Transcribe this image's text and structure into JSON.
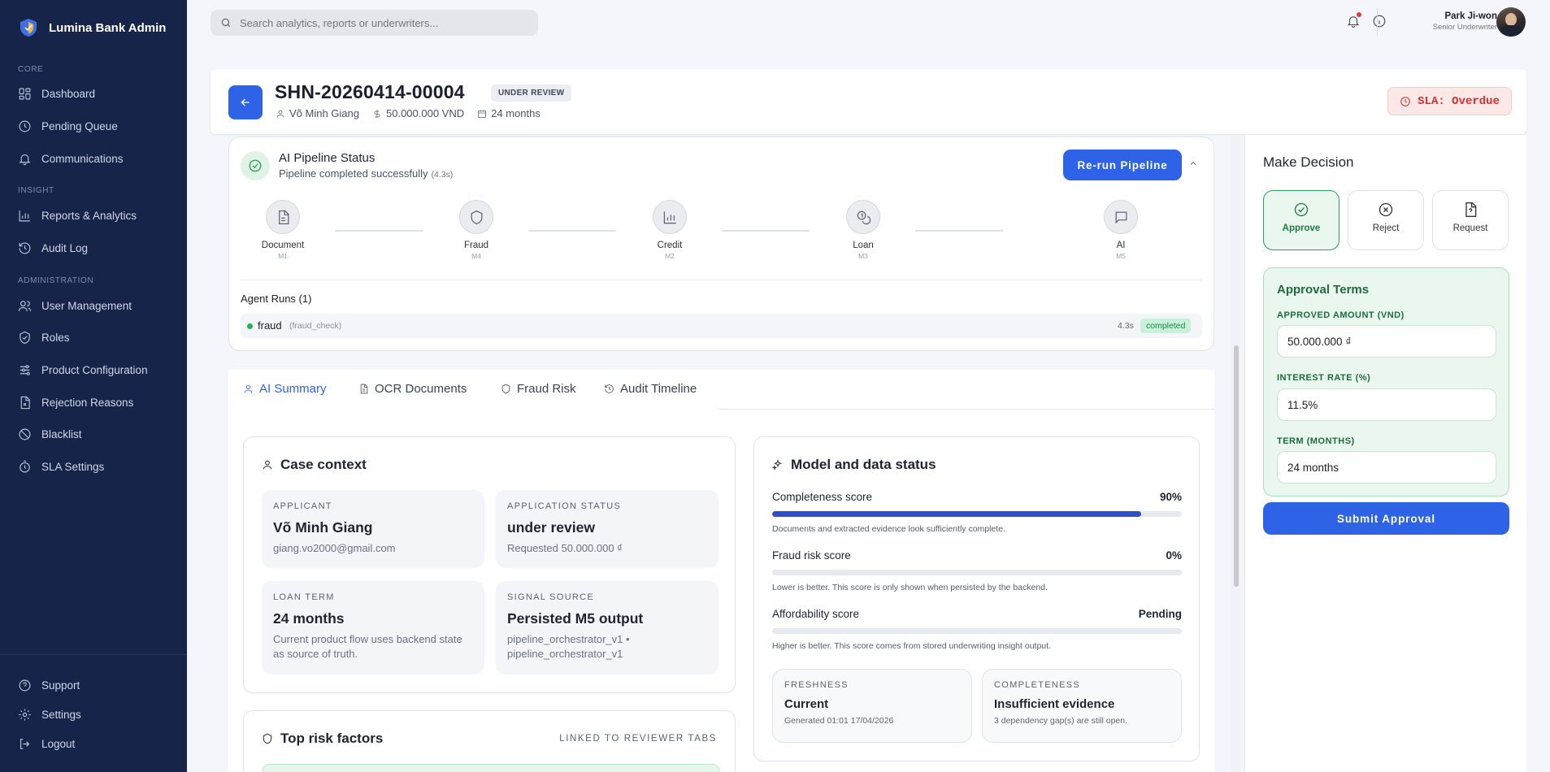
{
  "app": {
    "name": "Lumina Bank Admin"
  },
  "sidebar": {
    "sections": {
      "core": "CORE",
      "insight": "INSIGHT",
      "administration": "ADMINISTRATION"
    },
    "items": [
      {
        "label": "Dashboard",
        "icon": "grid-icon"
      },
      {
        "label": "Pending Queue",
        "icon": "clock-icon"
      },
      {
        "label": "Communications",
        "icon": "bell-icon"
      },
      {
        "label": "Reports & Analytics",
        "icon": "bar-chart-icon"
      },
      {
        "label": "Audit Log",
        "icon": "history-icon"
      },
      {
        "label": "User Management",
        "icon": "users-icon"
      },
      {
        "label": "Roles",
        "icon": "shield-check-icon"
      },
      {
        "label": "Product Configuration",
        "icon": "sliders-icon"
      },
      {
        "label": "Rejection Reasons",
        "icon": "file-x-icon"
      },
      {
        "label": "Blacklist",
        "icon": "ban-icon"
      },
      {
        "label": "SLA Settings",
        "icon": "timer-icon"
      }
    ],
    "footer": [
      {
        "label": "Support",
        "icon": "help-icon"
      },
      {
        "label": "Settings",
        "icon": "gear-icon"
      },
      {
        "label": "Logout",
        "icon": "logout-icon"
      }
    ]
  },
  "header": {
    "search_placeholder": "Search analytics, reports or underwriters...",
    "user": {
      "name": "Park Ji-won",
      "role": "Senior Underwriter"
    }
  },
  "case": {
    "id": "SHN-20260414-00004",
    "status_badge": "UNDER REVIEW",
    "applicant": "Võ Minh Giang",
    "amount": "50.000.000 VND",
    "term": "24 months",
    "sla": "SLA: Overdue"
  },
  "pipeline": {
    "title": "AI Pipeline Status",
    "subtitle": "Pipeline completed successfully",
    "duration": "(4.3s)",
    "rerun_label": "Re-run Pipeline",
    "steps": [
      {
        "label": "Document",
        "code": "M1",
        "icon": "document-icon"
      },
      {
        "label": "Fraud",
        "code": "M4",
        "icon": "shield-icon"
      },
      {
        "label": "Credit",
        "code": "M2",
        "icon": "bar-chart-icon"
      },
      {
        "label": "Loan",
        "code": "M3",
        "icon": "coins-icon"
      },
      {
        "label": "AI",
        "code": "M5",
        "icon": "message-icon"
      }
    ],
    "agent_runs_title": "Agent Runs (1)",
    "agent_runs": [
      {
        "name": "fraud",
        "type": "(fraud_check)",
        "time": "4.3s",
        "status": "completed"
      }
    ]
  },
  "tabs": [
    {
      "label": "AI Summary",
      "active": true
    },
    {
      "label": "OCR Documents",
      "active": false
    },
    {
      "label": "Fraud Risk",
      "active": false
    },
    {
      "label": "Audit Timeline",
      "active": false
    }
  ],
  "case_context": {
    "title": "Case context",
    "tiles": [
      {
        "key": "APPLICANT",
        "value": "Võ Minh Giang",
        "sub": "giang.vo2000@gmail.com"
      },
      {
        "key": "APPLICATION STATUS",
        "value": "under review",
        "sub": "Requested 50.000.000 ₫"
      },
      {
        "key": "LOAN TERM",
        "value": "24 months",
        "sub": "Current product flow uses backend state as source of truth."
      },
      {
        "key": "SIGNAL SOURCE",
        "value": "Persisted M5 output",
        "sub": "pipeline_orchestrator_v1 • pipeline_orchestrator_v1"
      }
    ]
  },
  "model_status": {
    "title": "Model and data status",
    "scores": [
      {
        "label": "Completeness score",
        "value": "90%",
        "fill": 0.9,
        "desc": "Documents and extracted evidence look sufficiently complete."
      },
      {
        "label": "Fraud risk score",
        "value": "0%",
        "fill": 0,
        "desc": "Lower is better. This score is only shown when persisted by the backend."
      },
      {
        "label": "Affordability score",
        "value": "Pending",
        "fill": 0,
        "desc": "Higher is better. This score comes from stored underwriting insight output."
      }
    ],
    "tiles": [
      {
        "key": "FRESHNESS",
        "value": "Current",
        "sub": "Generated 01:01 17/04/2026"
      },
      {
        "key": "COMPLETENESS",
        "value": "Insufficient evidence",
        "sub": "3 dependency gap(s) are still open."
      }
    ]
  },
  "risk_factors": {
    "title": "Top risk factors",
    "link": "LINKED TO REVIEWER TABS"
  },
  "decision": {
    "title": "Make Decision",
    "options": [
      {
        "label": "Approve",
        "selected": true
      },
      {
        "label": "Reject",
        "selected": false
      },
      {
        "label": "Request",
        "selected": false
      }
    ],
    "terms_title": "Approval Terms",
    "fields": [
      {
        "label": "APPROVED AMOUNT (VND)",
        "value": "50.000.000 ₫"
      },
      {
        "label": "INTEREST RATE (%)",
        "value": "11.5%"
      },
      {
        "label": "TERM (MONTHS)",
        "value": "24 months"
      }
    ],
    "submit_label": "Submit Approval"
  },
  "colors": {
    "primary": "#2e63e8",
    "sidebar": "#17244a",
    "success": "#2f9d5a",
    "danger": "#d32f2f"
  }
}
